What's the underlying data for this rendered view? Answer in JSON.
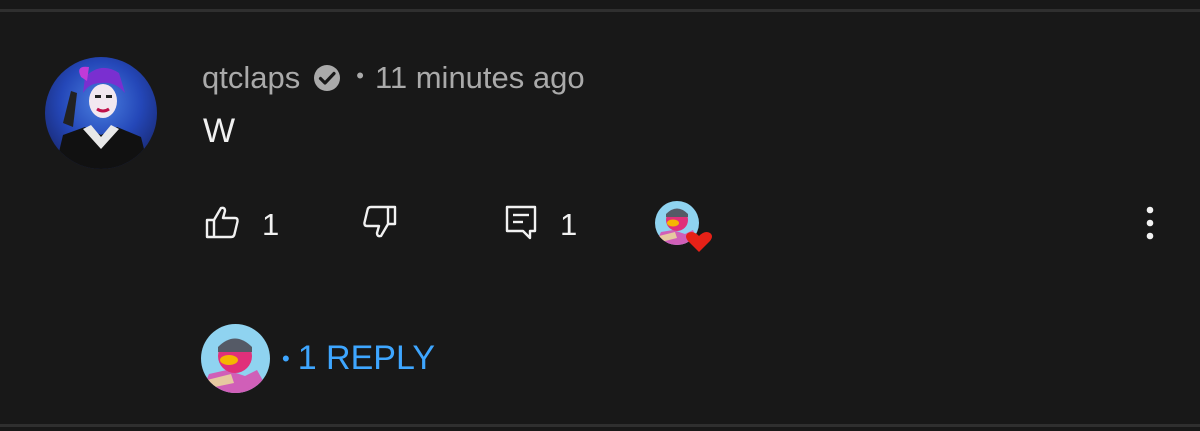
{
  "comment": {
    "author": "qtclaps",
    "separator": "•",
    "time": "11 minutes ago",
    "text": "W",
    "like_count": "1",
    "reply_count": "1",
    "verified": true
  },
  "replies": {
    "bullet": "•",
    "label": "1 REPLY"
  },
  "colors": {
    "background": "#181818",
    "text_primary": "#f1f1f1",
    "text_secondary": "#aaaaaa",
    "link": "#3ea6ff",
    "heart": "#e62117"
  },
  "icons": [
    "verified-badge-icon",
    "thumbs-up-icon",
    "thumbs-down-icon",
    "reply-comment-icon",
    "creator-heart-icon",
    "more-vertical-icon"
  ]
}
